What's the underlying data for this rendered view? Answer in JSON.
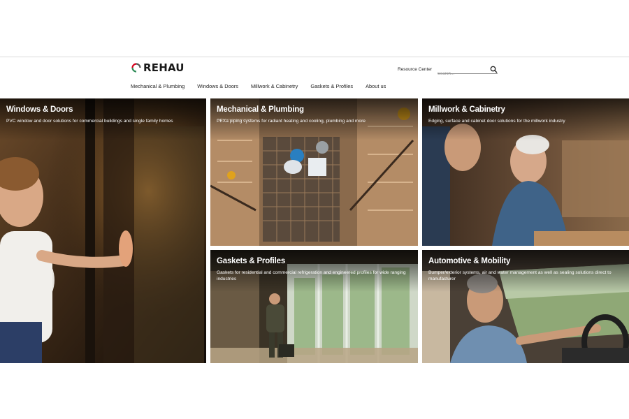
{
  "brand": {
    "name": "REHAU"
  },
  "header": {
    "resource_center": "Resource Center",
    "search_placeholder": "Search..."
  },
  "nav": [
    {
      "label": "Mechanical & Plumbing"
    },
    {
      "label": "Windows & Doors"
    },
    {
      "label": "Millwork & Cabinetry"
    },
    {
      "label": "Gaskets & Profiles"
    },
    {
      "label": "About us"
    }
  ],
  "tiles": {
    "windows": {
      "title": "Windows & Doors",
      "desc": "PVC window and door solutions for commercial buildings and single family homes"
    },
    "mechanical": {
      "title": "Mechanical & Plumbing",
      "desc": "PEXa piping systems for radiant heating and cooling, plumbing and more"
    },
    "millwork": {
      "title": "Millwork & Cabinetry",
      "desc": "Edging, surface and cabinet door solutions for the millwork industry"
    },
    "gaskets": {
      "title": "Gaskets & Profiles",
      "desc": "Gaskets for residential and commercial refrigeration and engineered profiles for wide ranging industries"
    },
    "automotive": {
      "title": "Automotive & Mobility",
      "desc": "Bumper/exterior systems, air and water management as well as sealing solutions direct to manufacturer"
    }
  },
  "icons": {
    "logo": "rehau-logo-icon",
    "search": "search-icon"
  },
  "colors": {
    "brand_red": "#d6001c",
    "brand_green": "#2e8b57",
    "text": "#222222"
  }
}
